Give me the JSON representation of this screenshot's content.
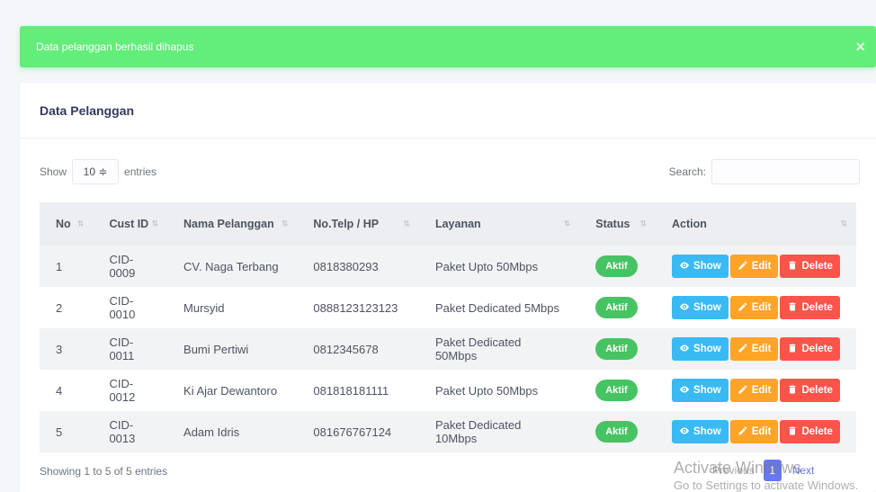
{
  "alert": {
    "message": "Data pelanggan berhasil dihapus",
    "close": "×"
  },
  "card": {
    "title": "Data Pelanggan"
  },
  "controls": {
    "show_label": "Show",
    "length_value": "10 ≑",
    "entries_label": "entries",
    "search_label": "Search:",
    "search_value": ""
  },
  "table": {
    "headers": [
      "No",
      "Cust ID",
      "Nama Pelanggan",
      "No.Telp / HP",
      "Layanan",
      "Status",
      "Action"
    ],
    "sort_glyph": "⇅",
    "rows": [
      [
        "1",
        "CID-0009",
        "CV. Naga Terbang",
        "0818380293",
        "Paket Upto 50Mbps",
        "Aktif"
      ],
      [
        "2",
        "CID-0010",
        "Mursyid",
        "0888123123123",
        "Paket Dedicated 5Mbps",
        "Aktif"
      ],
      [
        "3",
        "CID-0011",
        "Bumi Pertiwi",
        "0812345678",
        "Paket Dedicated 50Mbps",
        "Aktif"
      ],
      [
        "4",
        "CID-0012",
        "Ki Ajar Dewantoro",
        "081818181111",
        "Paket Upto 50Mbps",
        "Aktif"
      ],
      [
        "5",
        "CID-0013",
        "Adam Idris",
        "081676767124",
        "Paket Dedicated 10Mbps",
        "Aktif"
      ]
    ],
    "action_labels": {
      "show": "Show",
      "edit": "Edit",
      "delete": "Delete"
    }
  },
  "footer": {
    "info": "Showing 1 to 5 of 5 entries",
    "previous": "Previous",
    "current_page": "1",
    "next": "Next"
  },
  "watermark": {
    "line1": "Activate Windows",
    "line2": "Go to Settings to activate Windows."
  },
  "colors": {
    "success": "#63ed7a",
    "badge": "#47c363",
    "show": "#3abaf4",
    "edit": "#ffa426",
    "delete": "#fc544b",
    "primary": "#6777ef"
  }
}
